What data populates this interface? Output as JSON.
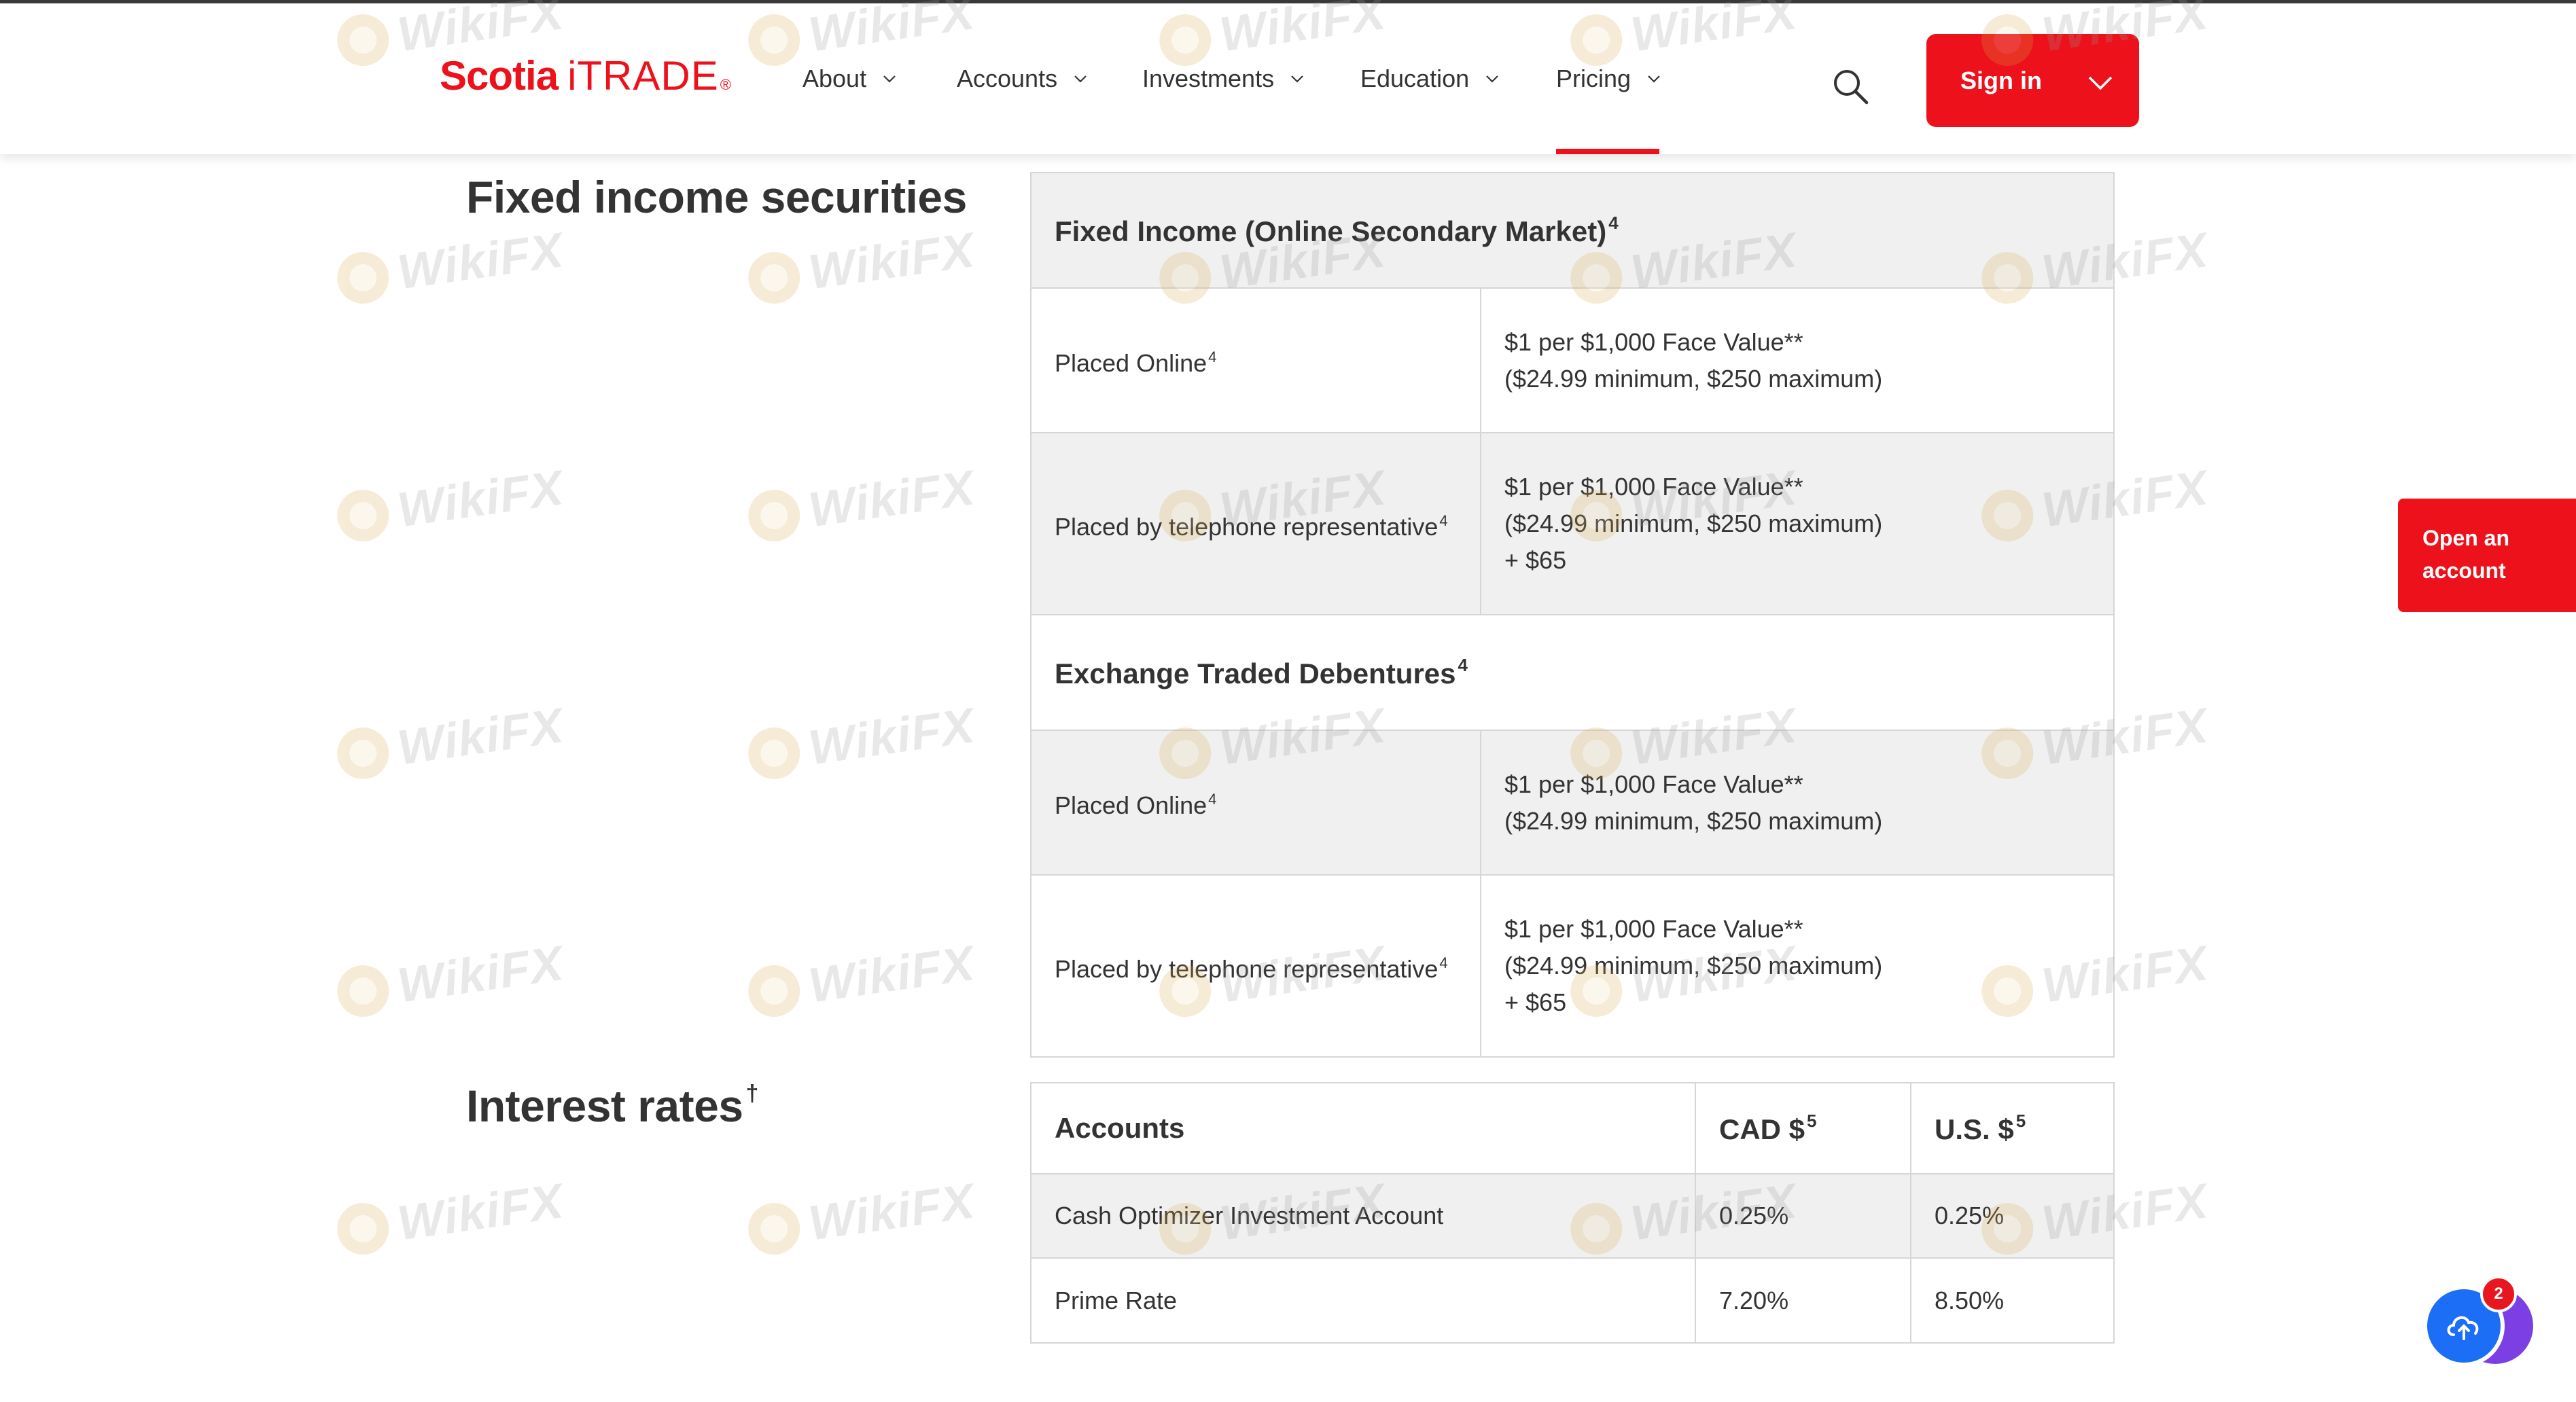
{
  "brand": {
    "name_bold": "Scotia",
    "name_light": "iTRADE",
    "registered": "®",
    "color": "#ec111a"
  },
  "nav": {
    "items": [
      {
        "label": "About"
      },
      {
        "label": "Accounts"
      },
      {
        "label": "Investments"
      },
      {
        "label": "Education"
      },
      {
        "label": "Pricing",
        "active": true
      }
    ],
    "sign_in_label": "Sign in",
    "search_icon": "search-icon",
    "sign_in_icon": "chevron-down-icon"
  },
  "fixed_income": {
    "title": "Fixed income securities",
    "title_sup": "",
    "sections": [
      {
        "heading": "Fixed Income (Online Secondary Market)",
        "heading_sup": "4",
        "rows": [
          {
            "label": "Placed Online",
            "label_sup": "4",
            "lines": [
              "$1 per $1,000 Face Value**",
              "($24.99 minimum, $250 maximum)"
            ]
          },
          {
            "label": "Placed by telephone representative",
            "label_sup": "4",
            "lines": [
              "$1 per $1,000 Face Value**",
              "($24.99 minimum, $250 maximum)",
              "+ $65"
            ]
          }
        ]
      },
      {
        "heading": "Exchange Traded Debentures",
        "heading_sup": "4",
        "rows": [
          {
            "label": "Placed Online",
            "label_sup": "4",
            "lines": [
              "$1 per $1,000 Face Value**",
              "($24.99 minimum, $250 maximum)"
            ]
          },
          {
            "label": "Placed by telephone representative",
            "label_sup": "4",
            "lines": [
              "$1 per $1,000 Face Value**",
              "($24.99 minimum, $250 maximum)",
              "+ $65"
            ]
          }
        ]
      }
    ]
  },
  "interest_rates": {
    "title": "Interest rates",
    "title_sup": "†",
    "headers": [
      {
        "label": "Accounts",
        "sup": ""
      },
      {
        "label": "CAD $",
        "sup": "5"
      },
      {
        "label": "U.S. $",
        "sup": "5"
      }
    ],
    "rows": [
      [
        "Cash Optimizer Investment Account",
        "0.25%",
        "0.25%"
      ],
      [
        "Prime Rate",
        "7.20%",
        "8.50%"
      ]
    ]
  },
  "side_tab": {
    "line1": "Open an",
    "line2": "account"
  },
  "chat_widget": {
    "badge": "2",
    "icon": "cloud-upload-icon"
  },
  "watermark": {
    "text": "WikiFX"
  }
}
